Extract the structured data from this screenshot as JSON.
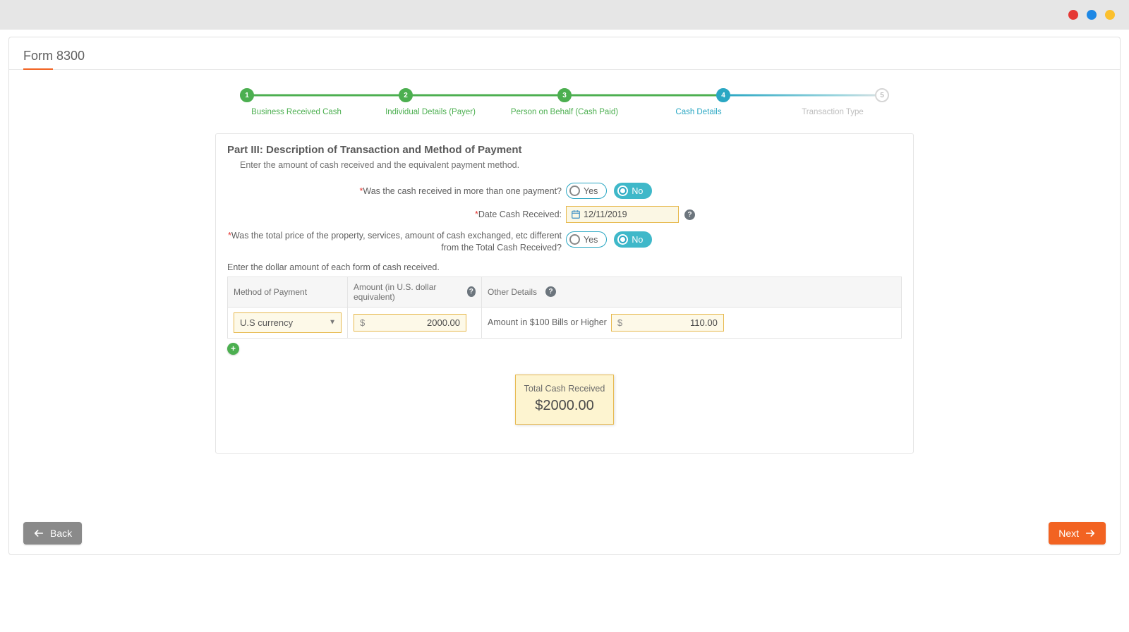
{
  "page": {
    "title": "Form 8300"
  },
  "stepper": {
    "steps": [
      {
        "num": "1",
        "label": "Business Received Cash",
        "state": "done"
      },
      {
        "num": "2",
        "label": "Individual Details (Payer)",
        "state": "done"
      },
      {
        "num": "3",
        "label": "Person on Behalf (Cash Paid)",
        "state": "done"
      },
      {
        "num": "4",
        "label": "Cash Details",
        "state": "active"
      },
      {
        "num": "5",
        "label": "Transaction Type",
        "state": "pending"
      }
    ]
  },
  "section": {
    "heading": "Part III: Description of Transaction and Method of Payment",
    "subtext": "Enter the amount of cash received and the equivalent payment method."
  },
  "q_multi_payment": {
    "label": "Was the cash received in more than one payment?",
    "yes": "Yes",
    "no": "No",
    "selected": "No"
  },
  "q_date": {
    "label": "Date Cash Received:",
    "value": "12/11/2019"
  },
  "q_price_diff": {
    "label": "Was the total price of the property, services, amount of cash exchanged, etc different from the Total Cash Received?",
    "yes": "Yes",
    "no": "No",
    "selected": "No"
  },
  "row_instr": "Enter the dollar amount of each form of cash received.",
  "table": {
    "hdr_method": "Method of Payment",
    "hdr_amount": "Amount (in U.S. dollar equivalent)",
    "hdr_other": "Other Details",
    "method_value": "U.S currency",
    "currency_prefix": "$",
    "amount_value": "2000.00",
    "other_label": "Amount in $100 Bills or Higher",
    "other_value": "110.00"
  },
  "total": {
    "label": "Total Cash Received",
    "value": "$2000.00"
  },
  "nav": {
    "back": "Back",
    "next": "Next"
  }
}
